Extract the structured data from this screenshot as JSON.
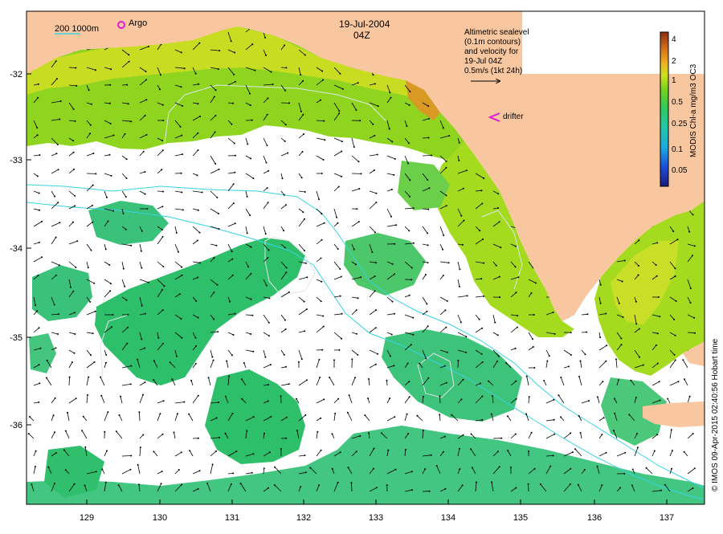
{
  "map": {
    "date": "19-Jul-2004",
    "time": "04Z",
    "scale_label": "200  1000m",
    "argo_label": "Argo",
    "drifter_label": "drifter",
    "legend_text": [
      "Altimetric sealevel",
      "(0.1m contours)",
      "and velocity for",
      "19-Jul 04Z",
      "0.5m/s (1kt 24h)"
    ],
    "credit": "© IMOS 09-Apr-2015 02:40:56 Hobart time",
    "colorbar_title": "MODIS Chl-a mg/m3 OC3",
    "colorbar_ticks": [
      "4",
      "2",
      "1",
      "0.5",
      "0.25",
      "0.1",
      "0.05"
    ],
    "x_ticks": [
      "129",
      "130",
      "131",
      "132",
      "133",
      "134",
      "135",
      "136",
      "137"
    ],
    "y_ticks": [
      "-32",
      "-33",
      "-34",
      "-35",
      "-36"
    ],
    "colors": {
      "land": "#f9c79f",
      "cloud": "#ffffff",
      "chl_high": "#b86019",
      "chl_mid": "#d6e21f",
      "chl_green": "#5ccf2f",
      "chl_low": "#2cc06e",
      "isobath": "#38d3e6",
      "contour": "#dce6e8",
      "argo": "#e01ad6",
      "drifter": "#e01ad6"
    }
  }
}
